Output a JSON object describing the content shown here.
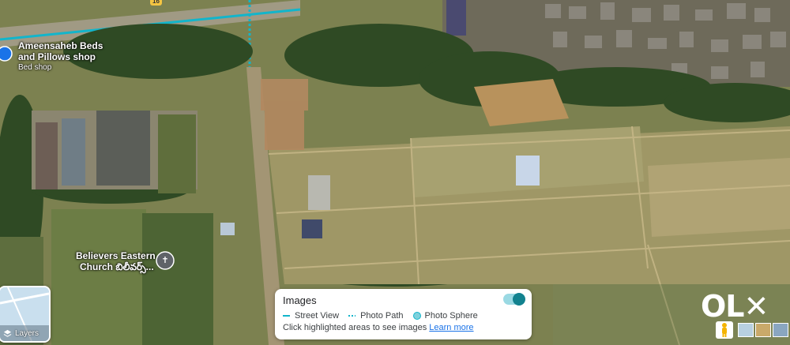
{
  "map": {
    "type": "satellite"
  },
  "poi": {
    "shop_name_line1": "Ameensaheb Beds",
    "shop_name_line2": "and Pillows shop",
    "shop_category": "Bed shop",
    "church_line1": "Believers Eastern",
    "church_line2": "Church బిలీవర్స్...",
    "road_shield": "16"
  },
  "images_panel": {
    "title": "Images",
    "legend": {
      "street_view": "Street View",
      "photo_path": "Photo Path",
      "photo_sphere": "Photo Sphere"
    },
    "hint": "Click highlighted areas to see images",
    "learn_more": "Learn more",
    "toggle_on": true
  },
  "layers_button": {
    "label": "Layers"
  },
  "watermark": {
    "text": "OLX"
  },
  "colors": {
    "street_view_line": "#12b5cb",
    "link": "#1a73e8",
    "toggle": "#12828f"
  },
  "icons": [
    "shopping-bag-icon",
    "cross-icon",
    "layers-icon",
    "pegman-icon",
    "close-icon"
  ]
}
